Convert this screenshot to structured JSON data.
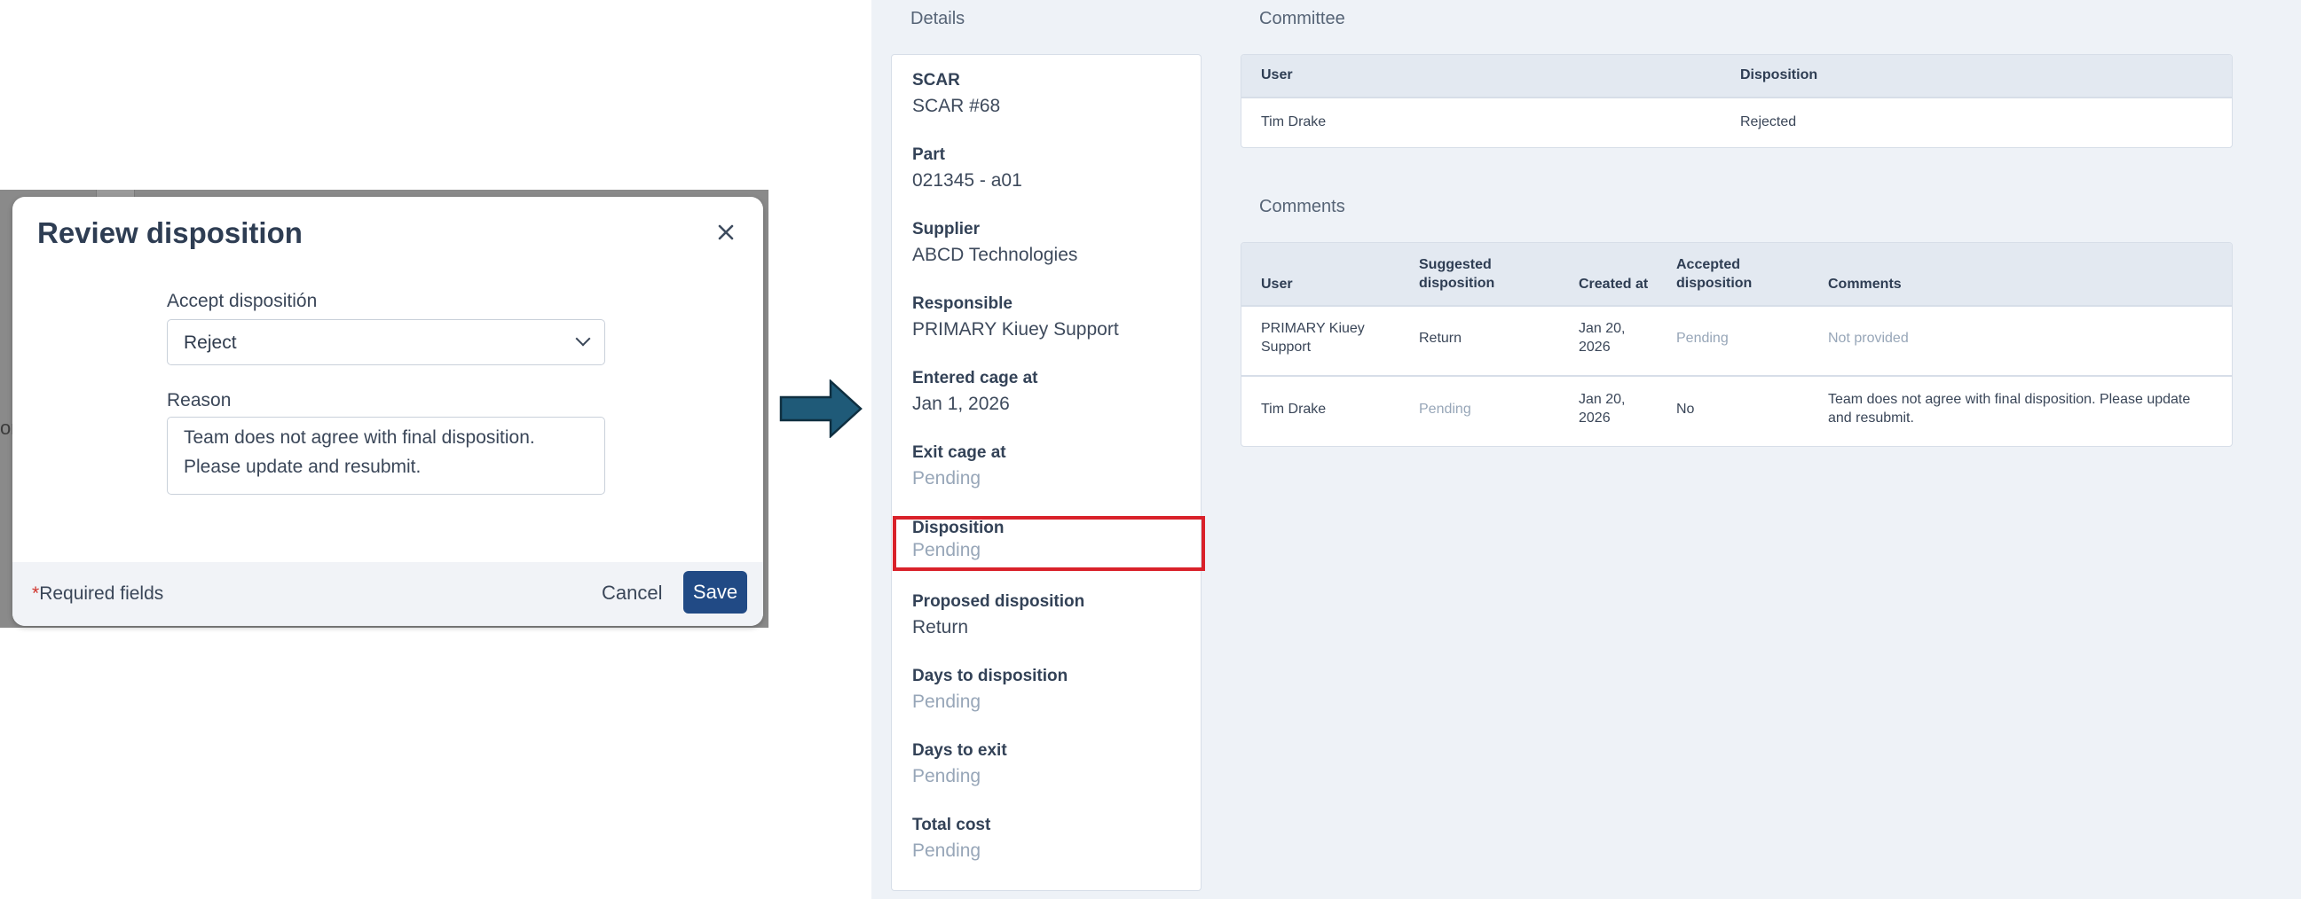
{
  "dialog": {
    "title": "Review disposition",
    "close_icon": "close-icon",
    "accept_label": "Accept dispositión",
    "accept_value": "Reject",
    "reason_label": "Reason",
    "reason_line1": "Team does not agree with final disposition.",
    "reason_line2": "Please update and resubmit.",
    "required_star": "*",
    "required_text": "Required fields",
    "cancel_label": "Cancel",
    "save_label": "Save",
    "backdrop_glyph": "or"
  },
  "arrow_icon": "arrow-right-icon",
  "details": {
    "section_title": "Details",
    "items": [
      {
        "label": "SCAR",
        "value": "SCAR #68",
        "muted": false
      },
      {
        "label": "Part",
        "value": "021345 - a01",
        "muted": false
      },
      {
        "label": "Supplier",
        "value": "ABCD Technologies",
        "muted": false
      },
      {
        "label": "Responsible",
        "value": "PRIMARY Kiuey Support",
        "muted": false
      },
      {
        "label": "Entered cage at",
        "value": "Jan 1, 2026",
        "muted": false
      },
      {
        "label": "Exit cage at",
        "value": "Pending",
        "muted": true
      },
      {
        "label": "Disposition",
        "value": "Pending",
        "muted": true
      },
      {
        "label": "Proposed disposition",
        "value": "Return",
        "muted": false
      },
      {
        "label": "Days to disposition",
        "value": "Pending",
        "muted": true
      },
      {
        "label": "Days to exit",
        "value": "Pending",
        "muted": true
      },
      {
        "label": "Total cost",
        "value": "Pending",
        "muted": true
      }
    ],
    "highlight_color": "#d9212a"
  },
  "committee": {
    "section_title": "Committee",
    "headers": [
      "User",
      "Disposition"
    ],
    "rows": [
      {
        "user": "Tim Drake",
        "disposition": "Rejected"
      }
    ]
  },
  "comments": {
    "section_title": "Comments",
    "headers": {
      "user": "User",
      "suggested_1": "Suggested",
      "suggested_2": "disposition",
      "created": "Created at",
      "accepted_1": "Accepted",
      "accepted_2": "disposition",
      "comments": "Comments"
    },
    "rows": [
      {
        "user_1": "PRIMARY Kiuey",
        "user_2": "Support",
        "suggested": "Return",
        "created_1": "Jan 20,",
        "created_2": "2026",
        "accepted": "Pending",
        "comment_1": "Not provided",
        "comment_2": ""
      },
      {
        "user_1": "Tim Drake",
        "user_2": "",
        "suggested": "Pending",
        "created_1": "Jan 20,",
        "created_2": "2026",
        "accepted": "No",
        "comment_1": "Team does not agree with final disposition. Please update",
        "comment_2": "and resubmit."
      }
    ]
  },
  "colors": {
    "primary_button": "#214a85",
    "arrow_fill": "#1f5a78",
    "muted_text": "#97a6b8",
    "page_background": "#eef2f7"
  }
}
